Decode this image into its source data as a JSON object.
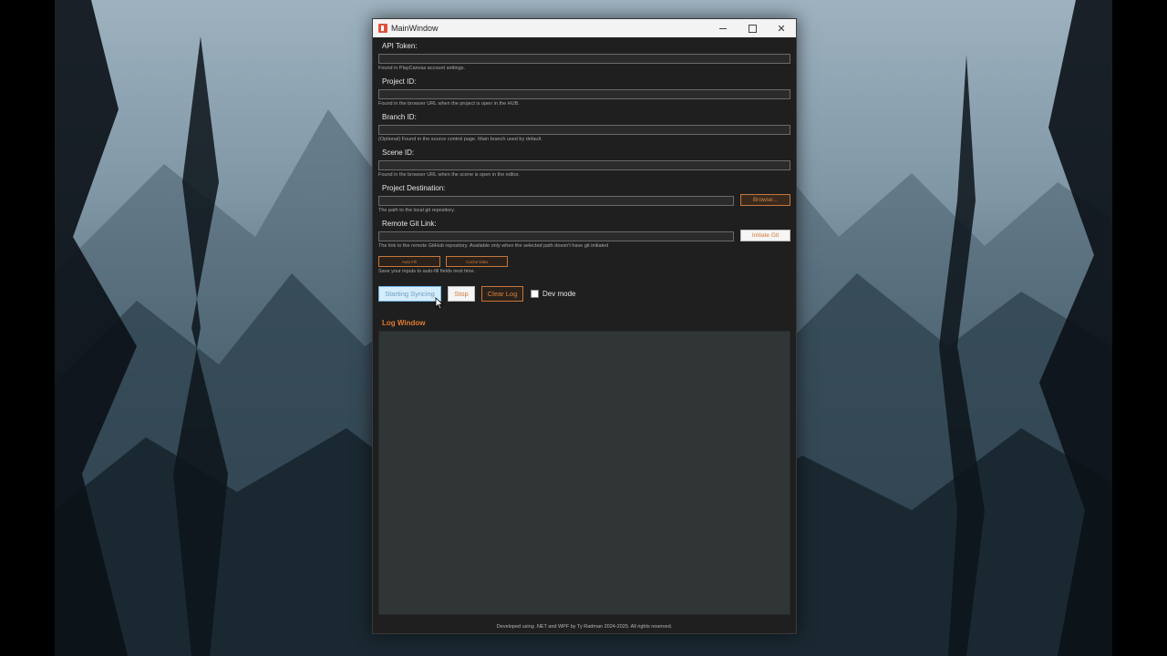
{
  "window": {
    "title": "MainWindow",
    "minimize": "",
    "maximize": "",
    "close": "✕"
  },
  "fields": {
    "api_token": {
      "label": "API Token:",
      "value": "",
      "help": "Found in PlayCanvas account settings."
    },
    "project_id": {
      "label": "Project ID:",
      "value": "",
      "help": "Found in the browser URL when the project is open in the HUB."
    },
    "branch_id": {
      "label": "Branch ID:",
      "value": "",
      "help": "(Optional) Found in the source control page. Main branch used by default."
    },
    "scene_id": {
      "label": "Scene ID:",
      "value": "",
      "help": "Found in the browser URL when the scene is open in the editor."
    },
    "project_destination": {
      "label": "Project Destination:",
      "value": "",
      "help": "The path to the local git repository.",
      "button": "Browse..."
    },
    "remote_git_link": {
      "label": "Remote Git Link:",
      "value": "",
      "help": "The link to the remote GitHub repository. Available only when the selected path doesn't have git initiated",
      "button": "Initiate Git"
    }
  },
  "autofill": {
    "auto_fill": "Auto Fill",
    "cache_data": "Cache Data",
    "help": "Save your inputs to auto-fill fields next time."
  },
  "actions": {
    "start": "Starting Syncing",
    "stop": "Stop",
    "clear_log": "Clear Log",
    "dev_mode": "Dev mode",
    "dev_mode_checked": false
  },
  "log": {
    "title": "Log Window"
  },
  "footer": "Developed using .NET and WPF by Ty Radman 2024-2025. All rights reserved.",
  "colors": {
    "accent": "#e07a2f",
    "window_bg": "#1f1f1f",
    "log_bg": "#303636",
    "start_bg": "#d5ecfb"
  }
}
